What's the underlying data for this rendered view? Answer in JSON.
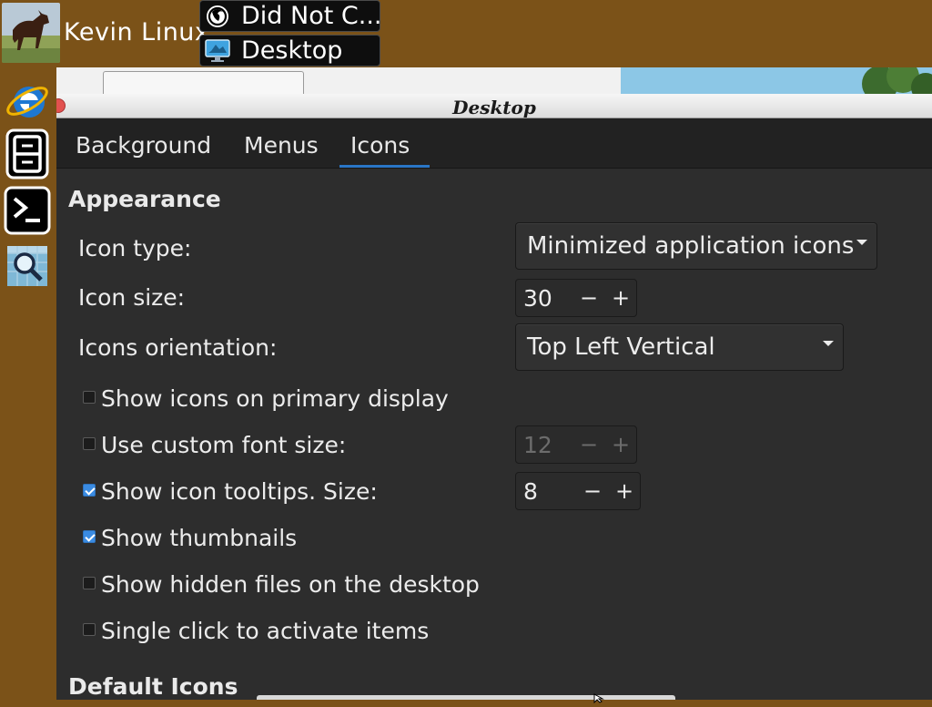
{
  "panel": {
    "user_name": "Kevin Linux",
    "tasks": [
      {
        "label": "Did Not C...",
        "icon": "firefox-icon"
      },
      {
        "label": "Desktop",
        "icon": "monitor-icon"
      }
    ]
  },
  "dock": [
    {
      "icon": "internet-explorer-icon"
    },
    {
      "icon": "file-cabinet-icon"
    },
    {
      "icon": "terminal-icon"
    },
    {
      "icon": "search-icon"
    }
  ],
  "dialog": {
    "title": "Desktop",
    "tabs": [
      {
        "label": "Background",
        "selected": false
      },
      {
        "label": "Menus",
        "selected": false
      },
      {
        "label": "Icons",
        "selected": true
      }
    ],
    "appearance": {
      "heading": "Appearance",
      "icon_type_label": "Icon type:",
      "icon_type_value": "Minimized application icons",
      "icon_size_label": "Icon size:",
      "icon_size_value": "30",
      "orientation_label": "Icons orientation:",
      "orientation_value": "Top Left Vertical",
      "options": [
        {
          "label": "Show icons on primary display",
          "checked": false
        },
        {
          "label": "Use custom font size:",
          "checked": false,
          "value": "12",
          "enabled": false
        },
        {
          "label": "Show icon tooltips. Size:",
          "checked": true,
          "value": "8",
          "enabled": true
        },
        {
          "label": "Show thumbnails",
          "checked": true
        },
        {
          "label": "Show hidden files on the desktop",
          "checked": false
        },
        {
          "label": "Single click to activate items",
          "checked": false
        }
      ]
    },
    "default_icons_heading": "Default Icons",
    "spin_minus": "−",
    "spin_plus": "+"
  },
  "colors": {
    "desktop_bg": "#7b5218",
    "dialog_bg": "#2d2d2d",
    "accent": "#2a76c6",
    "checkbox_checked": "#3a8be2"
  }
}
